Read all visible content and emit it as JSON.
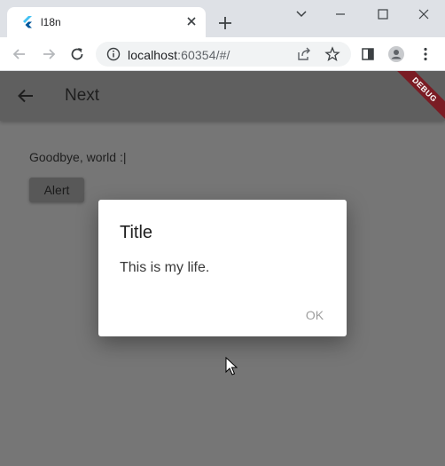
{
  "browser": {
    "tab_title": "l18n",
    "url_host": "localhost",
    "url_rest": ":60354/#/"
  },
  "app": {
    "appbar_title": "Next",
    "debug_banner": "DEBUG",
    "message": "Goodbye, world :|",
    "alert_button_label": "Alert"
  },
  "dialog": {
    "title": "Title",
    "content": "This is my life.",
    "ok_label": "OK"
  }
}
